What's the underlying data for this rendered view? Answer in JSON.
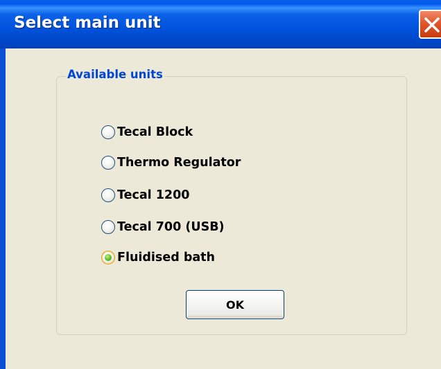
{
  "window": {
    "title": "Select main unit"
  },
  "group": {
    "legend": "Available units"
  },
  "radio_options": [
    {
      "label": "Tecal Block",
      "checked": false
    },
    {
      "label": "Thermo Regulator",
      "checked": false
    },
    {
      "label": "Tecal 1200",
      "checked": false
    },
    {
      "label": "Tecal 700 (USB)",
      "checked": false
    },
    {
      "label": "Fluidised bath",
      "checked": true
    }
  ],
  "buttons": {
    "ok_label": "OK"
  },
  "colors": {
    "titlebar": "#0054e3",
    "client_background": "#ece9d8",
    "group_legend": "#0046d5",
    "close_button": "#e2562c"
  },
  "icons": {
    "close": "close-x-icon"
  }
}
